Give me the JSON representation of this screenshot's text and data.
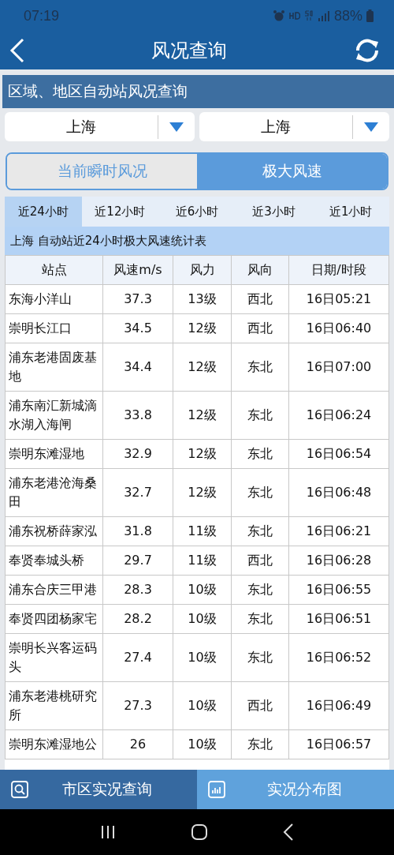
{
  "status_bar": {
    "time": "07:19",
    "battery": "88%"
  },
  "header": {
    "title": "风况查询"
  },
  "section_title": "区域、地区自动站风况查询",
  "dropdowns": [
    {
      "value": "上海"
    },
    {
      "value": "上海"
    }
  ],
  "mode_tabs": [
    {
      "label": "当前瞬时风况",
      "selected": false
    },
    {
      "label": "极大风速",
      "selected": true
    }
  ],
  "time_tabs": [
    {
      "label": "近24小时",
      "selected": true
    },
    {
      "label": "近12小时",
      "selected": false
    },
    {
      "label": "近6小时",
      "selected": false
    },
    {
      "label": "近3小时",
      "selected": false
    },
    {
      "label": "近1小时",
      "selected": false
    }
  ],
  "table": {
    "caption": "上海 自动站近24小时极大风速统计表",
    "columns": [
      "站点",
      "风速m/s",
      "风力",
      "风向",
      "日期/时段"
    ],
    "rows": [
      [
        "东海小洋山",
        "37.3",
        "13级",
        "西北",
        "16日05:21"
      ],
      [
        "崇明长江口",
        "34.5",
        "12级",
        "西北",
        "16日06:40"
      ],
      [
        "浦东老港固废基地",
        "34.4",
        "12级",
        "东北",
        "16日07:00"
      ],
      [
        "浦东南汇新城滴水湖入海闸",
        "33.8",
        "12级",
        "东北",
        "16日06:24"
      ],
      [
        "崇明东滩湿地",
        "32.9",
        "12级",
        "东北",
        "16日06:54"
      ],
      [
        "浦东老港沧海桑田",
        "32.7",
        "12级",
        "东北",
        "16日06:48"
      ],
      [
        "浦东祝桥薛家泓",
        "31.8",
        "11级",
        "东北",
        "16日06:21"
      ],
      [
        "奉贤奉城头桥",
        "29.7",
        "11级",
        "西北",
        "16日06:28"
      ],
      [
        "浦东合庆三甲港",
        "28.3",
        "10级",
        "东北",
        "16日06:55"
      ],
      [
        "奉贤四团杨家宅",
        "28.2",
        "10级",
        "东北",
        "16日06:51"
      ],
      [
        "崇明长兴客运码头",
        "27.4",
        "10级",
        "东北",
        "16日06:52"
      ],
      [
        "浦东老港桃研究所",
        "27.3",
        "10级",
        "西北",
        "16日06:49"
      ],
      [
        "崇明东滩湿地公",
        "26",
        "10级",
        "东北",
        "16日06:57"
      ]
    ]
  },
  "bottom_tabs": [
    {
      "label": "市区实况查询",
      "kind": "search",
      "selected": true
    },
    {
      "label": "实况分布图",
      "kind": "chart",
      "selected": false
    }
  ]
}
